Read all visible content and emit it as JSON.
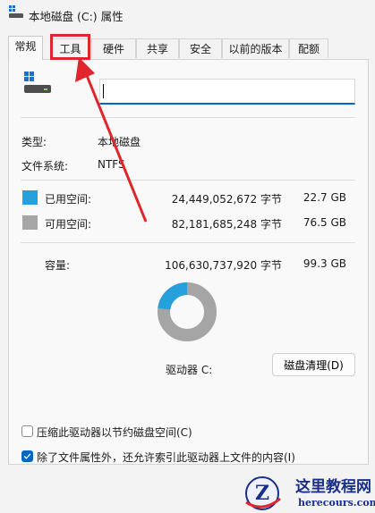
{
  "window": {
    "title": "本地磁盘 (C:) 属性",
    "icon": "drive-icon"
  },
  "tabs": [
    {
      "label": "常规",
      "active": true
    },
    {
      "label": "工具",
      "highlighted": true
    },
    {
      "label": "硬件"
    },
    {
      "label": "共享"
    },
    {
      "label": "安全"
    },
    {
      "label": "以前的版本"
    },
    {
      "label": "配额"
    }
  ],
  "general": {
    "drive_name_value": "",
    "type_label": "类型:",
    "type_value": "本地磁盘",
    "fs_label": "文件系统:",
    "fs_value": "NTFS",
    "used_label": "已用空间:",
    "used_bytes": "24,449,052,672 字节",
    "used_gb": "22.7 GB",
    "free_label": "可用空间:",
    "free_bytes": "82,181,685,248 字节",
    "free_gb": "76.5 GB",
    "capacity_label": "容量:",
    "capacity_bytes": "106,630,737,920 字节",
    "capacity_gb": "99.3 GB",
    "used_fraction": 0.229,
    "drive_label": "驱动器 C:",
    "cleanup_button": "磁盘清理(D)",
    "compress_label": "压缩此驱动器以节约磁盘空间(C)",
    "compress_checked": false,
    "index_label": "除了文件属性外，还允许索引此驱动器上文件的内容(I)",
    "index_checked": true
  },
  "colors": {
    "used": "#26a0da",
    "free": "#a5a5a5",
    "accent": "#0067c0",
    "annotation": "#e0262a"
  },
  "watermark": {
    "title": "这里教程网",
    "url": "herecours.com"
  }
}
